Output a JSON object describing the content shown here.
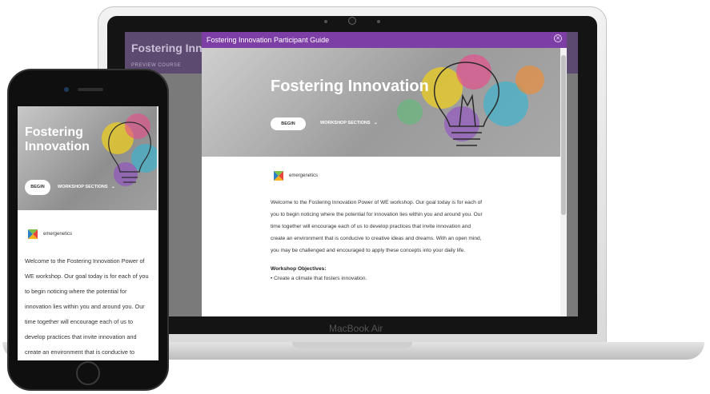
{
  "laptop": {
    "brand": "MacBook Air",
    "background_page": {
      "title": "Fostering Inno",
      "subtitle": "PREVIEW COURSE"
    },
    "modal": {
      "title": "Fostering Innovation Participant Guide",
      "hero_title": "Fostering Innovation",
      "begin_label": "BEGIN",
      "sections_label": "WORKSHOP SECTIONS",
      "logo_text": "emergenetics",
      "paragraph": "Welcome to the Fostering Innovation Power of WE workshop. Our goal today is for each of you to begin noticing where the potential for innovation lies within you and around you. Our time together will encourage each of us to develop practices that invite innovation and create an environment that is conducive to creative ideas and dreams. With an open mind, you may be challenged and encouraged to apply these concepts into your daily life.",
      "objectives_title": "Workshop Objectives:",
      "objectives": [
        "Create a climate that fosters innovation."
      ]
    }
  },
  "phone": {
    "hero_title": "Fostering Innovation",
    "begin_label": "BEGIN",
    "sections_label": "WORKSHOP SECTIONS",
    "logo_text": "emergenetics",
    "paragraph": "Welcome to the Fostering Innovation Power of WE workshop. Our goal today is for each of you to begin noticing where the potential for innovation lies within you and around you. Our time together will encourage each of us to develop practices that invite innovation and create an environment that is conducive to creative ideas and"
  },
  "colors": {
    "accent": "#7d3fa6",
    "background_header": "#5d4a70"
  }
}
